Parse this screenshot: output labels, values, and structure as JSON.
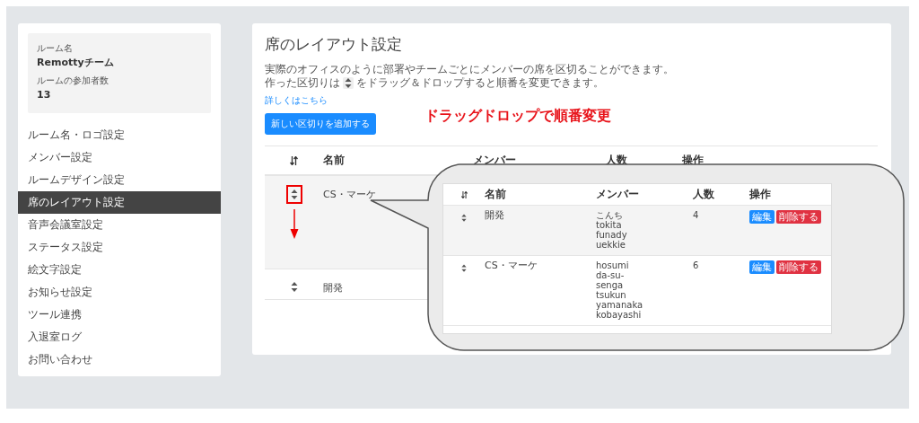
{
  "sidebar": {
    "room_label": "ルーム名",
    "room_name": "Remottyチーム",
    "members_label": "ルームの参加者数",
    "members_count": "13",
    "items": [
      {
        "label": "ルーム名・ロゴ設定",
        "selected": false
      },
      {
        "label": "メンバー設定",
        "selected": false
      },
      {
        "label": "ルームデザイン設定",
        "selected": false
      },
      {
        "label": "席のレイアウト設定",
        "selected": true
      },
      {
        "label": "音声会議室設定",
        "selected": false
      },
      {
        "label": "ステータス設定",
        "selected": false
      },
      {
        "label": "絵文字設定",
        "selected": false
      },
      {
        "label": "お知らせ設定",
        "selected": false
      },
      {
        "label": "ツール連携",
        "selected": false
      },
      {
        "label": "入退室ログ",
        "selected": false
      },
      {
        "label": "お問い合わせ",
        "selected": false
      }
    ]
  },
  "main": {
    "title": "席のレイアウト設定",
    "description": "実際のオフィスのように部署やチームごとにメンバーの席を区切ることができます。",
    "hint_before": "作った区切りは",
    "hint_after": "をドラッグ＆ドロップすると順番を変更できます。",
    "link": "詳しくはこちら",
    "add_button": "新しい区切りを追加する"
  },
  "annotation": "ドラッグドロップで順番変更",
  "table": {
    "columns": [
      "名前",
      "メンバー",
      "人数",
      "操作"
    ],
    "rows": [
      {
        "name": "CS・マーケ",
        "dragging": true
      },
      {
        "name": "開発",
        "dragging": false
      }
    ]
  },
  "callout": {
    "columns": [
      "名前",
      "メンバー",
      "人数",
      "操作"
    ],
    "rows": [
      {
        "name": "開発",
        "members": [
          "こんち",
          "tokita",
          "funady",
          "uekkie"
        ],
        "count": "4",
        "edit_button": "編集",
        "delete_button": "削除する"
      },
      {
        "name": "CS・マーケ",
        "members": [
          "hosumi",
          "da-su-",
          "senga",
          "tsukun",
          "yamanaka",
          "kobayashi"
        ],
        "count": "6",
        "edit_button": "編集",
        "delete_button": "削除する"
      }
    ]
  }
}
